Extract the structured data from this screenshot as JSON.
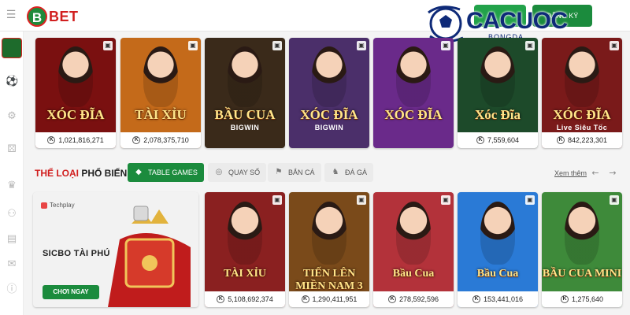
{
  "header": {
    "logo_text": "BET",
    "logo_mark": "B",
    "button_a": "",
    "button_b": "ĐĂNG KÝ"
  },
  "watermark": {
    "text": "CACUOC",
    "sub": "BONGDA"
  },
  "sidebar": {
    "icons": [
      "soccer-ball-icon",
      "gear-circle-icon",
      "dice-icon",
      "crown-icon",
      "add-user-icon",
      "document-icon",
      "chat-icon",
      "info-icon"
    ]
  },
  "live_games": [
    {
      "title": "XÓC ĐĨA",
      "subtitle": "",
      "amount": "1,021,816,271",
      "bg": "#7a1010"
    },
    {
      "title": "TÀI XỈU",
      "subtitle": "",
      "amount": "2,078,375,710",
      "bg": "#c46a1a"
    },
    {
      "title": "BẦU CUA",
      "subtitle": "BIGWIN",
      "amount": "",
      "bg": "#3a2a1a"
    },
    {
      "title": "XÓC ĐĨA",
      "subtitle": "BIGWIN",
      "amount": "",
      "bg": "#4b2f6a"
    },
    {
      "title": "XÓC ĐĨA",
      "subtitle": "",
      "amount": "",
      "bg": "#6a2a8a"
    },
    {
      "title": "Xóc Đĩa",
      "subtitle": "",
      "amount": "7,559,604",
      "bg": "#1d4a2a"
    },
    {
      "title": "XÓC ĐĨA",
      "subtitle": "Live Siêu Tốc",
      "amount": "842,223,301",
      "bg": "#7a1a1a"
    }
  ],
  "categories": {
    "title_red": "THỂ LOẠI",
    "title_dark": "PHỔ BIẾN",
    "tabs": [
      {
        "label": "TABLE GAMES",
        "icon": "table-games-icon",
        "active": true
      },
      {
        "label": "QUAY SỐ",
        "icon": "lottery-icon",
        "active": false
      },
      {
        "label": "BẮN CÁ",
        "icon": "fish-icon",
        "active": false
      },
      {
        "label": "ĐÁ GÀ",
        "icon": "rooster-icon",
        "active": false
      }
    ],
    "see_more": "Xem thêm"
  },
  "featured": {
    "provider": "Techplay",
    "title": "SICBO TÀI PHÚ",
    "play_label": "CHƠI NGAY"
  },
  "table_games": [
    {
      "title": "TÀI XỈU",
      "amount": "5,108,692,374",
      "bg": "#8a2020"
    },
    {
      "title": "TIẾN LÊN MIỀN NAM 3",
      "amount": "1,290,411,951",
      "bg": "#7a4a1a"
    },
    {
      "title": "Bầu Cua",
      "amount": "278,592,596",
      "bg": "#b3323a"
    },
    {
      "title": "Bầu Cua",
      "amount": "153,441,016",
      "bg": "#2a7ad6"
    },
    {
      "title": "BẦU CUA MINI",
      "amount": "1,275,640",
      "bg": "#3e8a3a"
    }
  ],
  "colors": {
    "brand_red": "#d11f1f",
    "brand_green": "#1b8b3d",
    "watermark_blue": "#0e2a78"
  }
}
